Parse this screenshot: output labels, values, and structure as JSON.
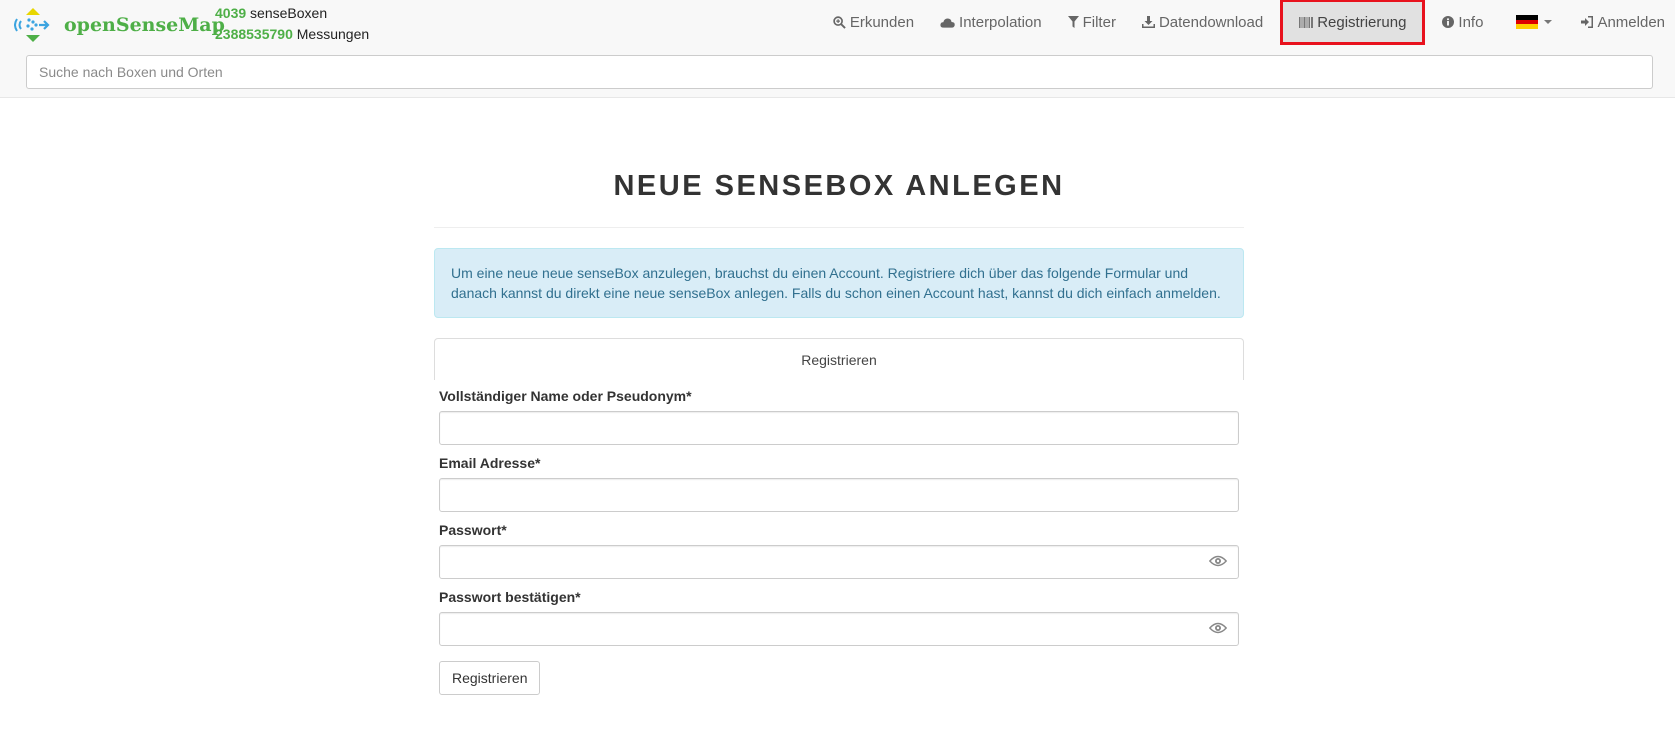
{
  "brand": {
    "name": "openSenseMap"
  },
  "stats": {
    "boxes_count": "4039",
    "boxes_label": "senseBoxen",
    "measurements_count": "2388535790",
    "measurements_label": "Messungen"
  },
  "nav": {
    "items": [
      {
        "label": "Erkunden",
        "icon": "search-plus-icon"
      },
      {
        "label": "Interpolation",
        "icon": "cloud-icon"
      },
      {
        "label": "Filter",
        "icon": "filter-icon"
      },
      {
        "label": "Datendownload",
        "icon": "download-icon"
      },
      {
        "label": "Registrierung",
        "icon": "barcode-icon",
        "active": true
      },
      {
        "label": "Info",
        "icon": "info-circle-icon"
      },
      {
        "label": "Anmelden",
        "icon": "sign-in-icon"
      }
    ],
    "language": "de"
  },
  "search": {
    "placeholder": "Suche nach Boxen und Orten"
  },
  "main": {
    "title": "NEUE SENSEBOX ANLEGEN",
    "info": "Um eine neue neue senseBox anzulegen, brauchst du einen Account. Registriere dich über das folgende Formular und danach kannst du direkt eine neue senseBox anlegen. Falls du schon einen Account hast, kannst du dich einfach anmelden.",
    "tab": "Registrieren",
    "fields": {
      "name": "Vollständiger Name oder Pseudonym*",
      "email": "Email Adresse*",
      "password": "Passwort*",
      "password_confirm": "Passwort bestätigen*"
    },
    "submit": "Registrieren"
  },
  "colors": {
    "brand_green": "#4eaf47",
    "active_outline": "#e8121d",
    "alert_bg": "#d9edf7",
    "alert_text": "#31708f"
  }
}
